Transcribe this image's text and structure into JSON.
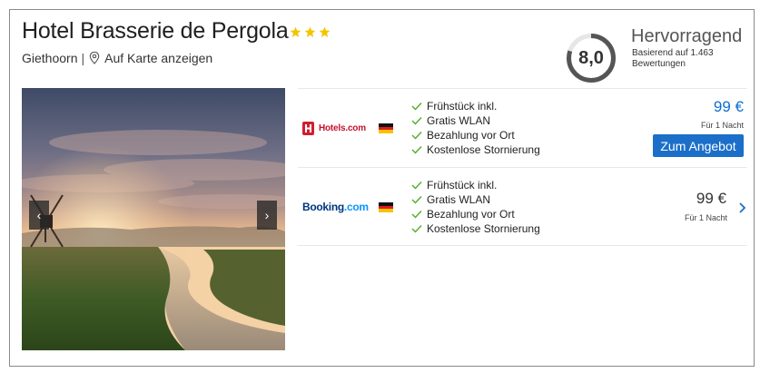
{
  "hotel": {
    "name": "Hotel Brasserie de Pergola",
    "stars": 3,
    "city": "Giethoorn",
    "separator": "|",
    "map_link": "Auf Karte anzeigen"
  },
  "rating": {
    "score": "8,0",
    "score_fraction": 0.8,
    "label": "Hervorragend",
    "basis": "Basierend auf 1.463 Bewertungen"
  },
  "gallery": {
    "prev_icon": "‹",
    "next_icon": "›"
  },
  "offers": [
    {
      "provider": "Hotels.com",
      "amenities": [
        "Frühstück inkl.",
        "Gratis WLAN",
        "Bezahlung vor Ort",
        "Kostenlose Stornierung"
      ],
      "price": "99 €",
      "price_note": "Für 1 Nacht",
      "button_label": "Zum Angebot"
    },
    {
      "provider_name": "Booking",
      "provider_suffix": ".com",
      "amenities": [
        "Frühstück inkl.",
        "Gratis WLAN",
        "Bezahlung vor Ort",
        "Kostenlose Stornierung"
      ],
      "price": "99 €",
      "price_note": "Für 1 Nacht"
    }
  ],
  "colors": {
    "accent_blue": "#1b6fc9",
    "price_blue": "#0d6fd1",
    "check_green": "#4caf28",
    "star_gold": "#f5c400",
    "rating_ring": "#555555"
  },
  "icons": {
    "star": "star-icon",
    "map_pin": "map-pin-icon",
    "check": "check-icon",
    "flag": "germany-flag-icon",
    "chevron": "chevron-right-icon"
  }
}
